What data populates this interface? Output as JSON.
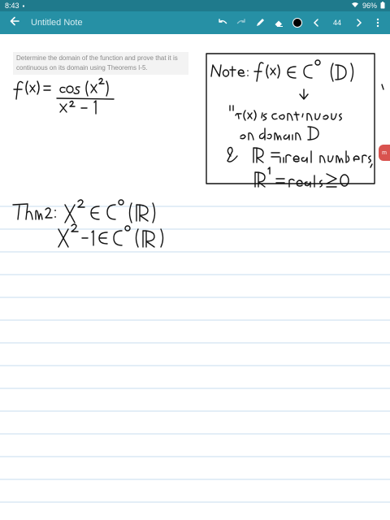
{
  "status_bar": {
    "time": "8:43",
    "battery": "96%"
  },
  "app_bar": {
    "title": "Untitled Note",
    "page_count": "44",
    "pen_color": "#000000",
    "icons": [
      "back-arrow-icon",
      "undo-icon",
      "redo-icon",
      "pen-icon",
      "eraser-icon",
      "color-dot",
      "chevron-left-icon",
      "chevron-right-icon",
      "more-vertical-icon"
    ]
  },
  "colors": {
    "status_bar": "#1f7a8c",
    "app_bar": "#2690a5",
    "ruled_line": "#c7dcef"
  },
  "question": {
    "text": "Determine the domain of the function and prove that it is continuous on its domain using Theorems I-5."
  }
}
